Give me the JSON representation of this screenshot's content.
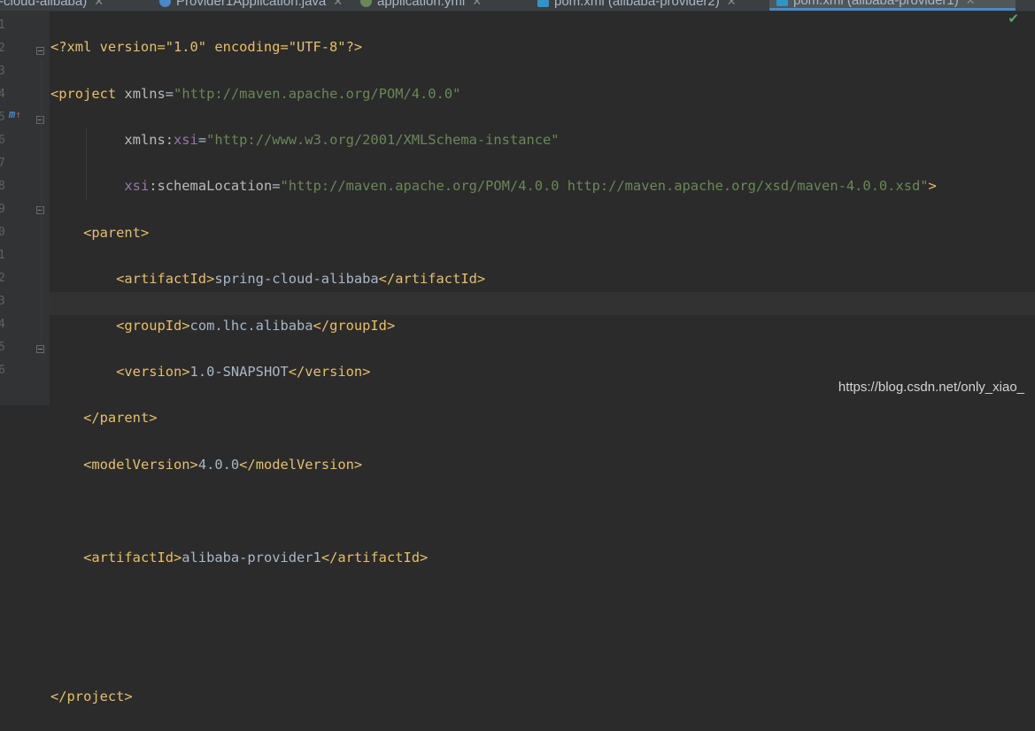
{
  "tabs": [
    {
      "label": "ring-cloud-alibaba)",
      "icon": ""
    },
    {
      "label": "Provider1Application.java",
      "icon": "java-class-icon"
    },
    {
      "label": "application.yml",
      "icon": "yaml-file-icon"
    },
    {
      "label": "pom.xml (alibaba-provider2)",
      "icon": "maven-icon"
    },
    {
      "label": "pom.xml (alibaba-provider1)",
      "icon": "maven-icon",
      "active": true
    }
  ],
  "gutter": {
    "override_marker": "m",
    "override_arrow": "↑"
  },
  "code": {
    "l1_decl": "<?xml version=\"1.0\" encoding=\"UTF-8\"?>",
    "l2_tag": "<project",
    "l2_attr": "xmlns",
    "l2_val": "\"http://maven.apache.org/POM/4.0.0\"",
    "l3_attr": "xmlns:",
    "l3_ns": "xsi",
    "l3_val": "\"http://www.w3.org/2001/XMLSchema-instance\"",
    "l4_ns": "xsi",
    "l4_attr": ":schemaLocation",
    "l4_val": "\"http://maven.apache.org/POM/4.0.0 http://maven.apache.org/xsd/maven-4.0.0.xsd\"",
    "l4_end": ">",
    "parent_open": "<parent>",
    "artifact_open": "<artifactId>",
    "parent_artifact": "spring-cloud-alibaba",
    "artifact_close": "</artifactId>",
    "group_open": "<groupId>",
    "group_value": "com.lhc.alibaba",
    "group_close": "</groupId>",
    "version_open": "<version>",
    "version_value": "1.0-SNAPSHOT",
    "version_close": "</version>",
    "parent_close": "</parent>",
    "model_open": "<modelVersion>",
    "model_value": "4.0.0",
    "model_close": "</modelVersion>",
    "artifact_value": "alibaba-provider1",
    "project_close": "</project>"
  },
  "watermark": "https://blog.csdn.net/only_xiao_",
  "colors": {
    "tag": "#e8bf6a",
    "attr": "#bababa",
    "namespace": "#9876aa",
    "value": "#6a8759",
    "text": "#a9b7c6",
    "accent": "#4a88c7"
  }
}
